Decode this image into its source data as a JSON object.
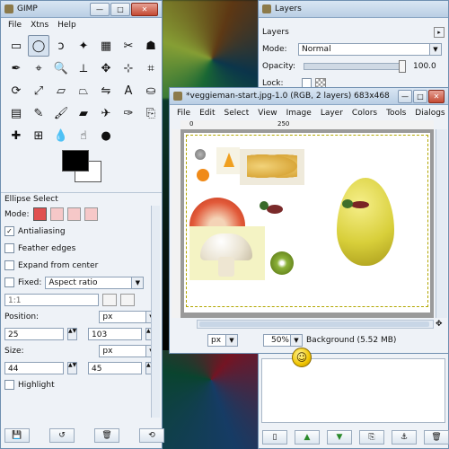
{
  "toolbox": {
    "title": "GIMP",
    "menus": [
      "File",
      "Xtns",
      "Help"
    ],
    "tools": [
      {
        "name": "rect-select-icon",
        "glyph": "▭"
      },
      {
        "name": "ellipse-select-icon",
        "glyph": "◯"
      },
      {
        "name": "lasso-icon",
        "glyph": "ↄ"
      },
      {
        "name": "fuzzy-select-icon",
        "glyph": "✦"
      },
      {
        "name": "color-select-icon",
        "glyph": "▦"
      },
      {
        "name": "scissors-icon",
        "glyph": "✂"
      },
      {
        "name": "foreground-select-icon",
        "glyph": "☗"
      },
      {
        "name": "paths-icon",
        "glyph": "✒"
      },
      {
        "name": "color-picker-icon",
        "glyph": "⌖"
      },
      {
        "name": "zoom-icon",
        "glyph": "🔍"
      },
      {
        "name": "measure-icon",
        "glyph": "⟂"
      },
      {
        "name": "move-icon",
        "glyph": "✥"
      },
      {
        "name": "align-icon",
        "glyph": "⊹"
      },
      {
        "name": "crop-icon",
        "glyph": "⌗"
      },
      {
        "name": "rotate-icon",
        "glyph": "⟳"
      },
      {
        "name": "scale-icon",
        "glyph": "⤢"
      },
      {
        "name": "shear-icon",
        "glyph": "▱"
      },
      {
        "name": "perspective-icon",
        "glyph": "⏢"
      },
      {
        "name": "flip-icon",
        "glyph": "⇋"
      },
      {
        "name": "text-icon",
        "glyph": "A"
      },
      {
        "name": "bucket-fill-icon",
        "glyph": "⛀"
      },
      {
        "name": "blend-icon",
        "glyph": "▤"
      },
      {
        "name": "pencil-icon",
        "glyph": "✎"
      },
      {
        "name": "paintbrush-icon",
        "glyph": "🖌"
      },
      {
        "name": "eraser-icon",
        "glyph": "▰"
      },
      {
        "name": "airbrush-icon",
        "glyph": "✈"
      },
      {
        "name": "ink-icon",
        "glyph": "✑"
      },
      {
        "name": "clone-icon",
        "glyph": "⎘"
      },
      {
        "name": "heal-icon",
        "glyph": "✚"
      },
      {
        "name": "perspective-clone-icon",
        "glyph": "⊞"
      },
      {
        "name": "blur-icon",
        "glyph": "💧"
      },
      {
        "name": "smudge-icon",
        "glyph": "☝"
      },
      {
        "name": "dodge-burn-icon",
        "glyph": "●"
      }
    ],
    "fg_color": "#000000",
    "bg_color": "#ffffff",
    "options_title": "Ellipse Select",
    "mode_label": "Mode:",
    "antialiasing": {
      "label": "Antialiasing",
      "checked": "✓"
    },
    "feather": {
      "label": "Feather edges"
    },
    "expand": {
      "label": "Expand from center"
    },
    "fixed": {
      "label": "Fixed:",
      "value": "Aspect ratio"
    },
    "ratio_value": "1:1",
    "position": {
      "label": "Position:",
      "unit": "px",
      "x": "25",
      "y": "103"
    },
    "size": {
      "label": "Size:",
      "unit": "px",
      "w": "44",
      "h": "45"
    },
    "highlight": {
      "label": "Highlight"
    }
  },
  "layers": {
    "title": "Layers",
    "section": "Layers",
    "mode_label": "Mode:",
    "mode_value": "Normal",
    "opacity_label": "Opacity:",
    "opacity_value": "100.0",
    "lock_label": "Lock:"
  },
  "image": {
    "title": "*veggieman-start.jpg-1.0 (RGB, 2 layers) 683x468",
    "menus": [
      "File",
      "Edit",
      "Select",
      "View",
      "Image",
      "Layer",
      "Colors",
      "Tools",
      "Dialogs"
    ],
    "ruler_ticks": [
      "0",
      "250"
    ],
    "unit": "px",
    "zoom": "50%",
    "status": "Background (5.52 MB)"
  },
  "colors": {
    "accent": "#c44a33",
    "selection": "#b2a600",
    "egg": "#d8cf3a"
  }
}
